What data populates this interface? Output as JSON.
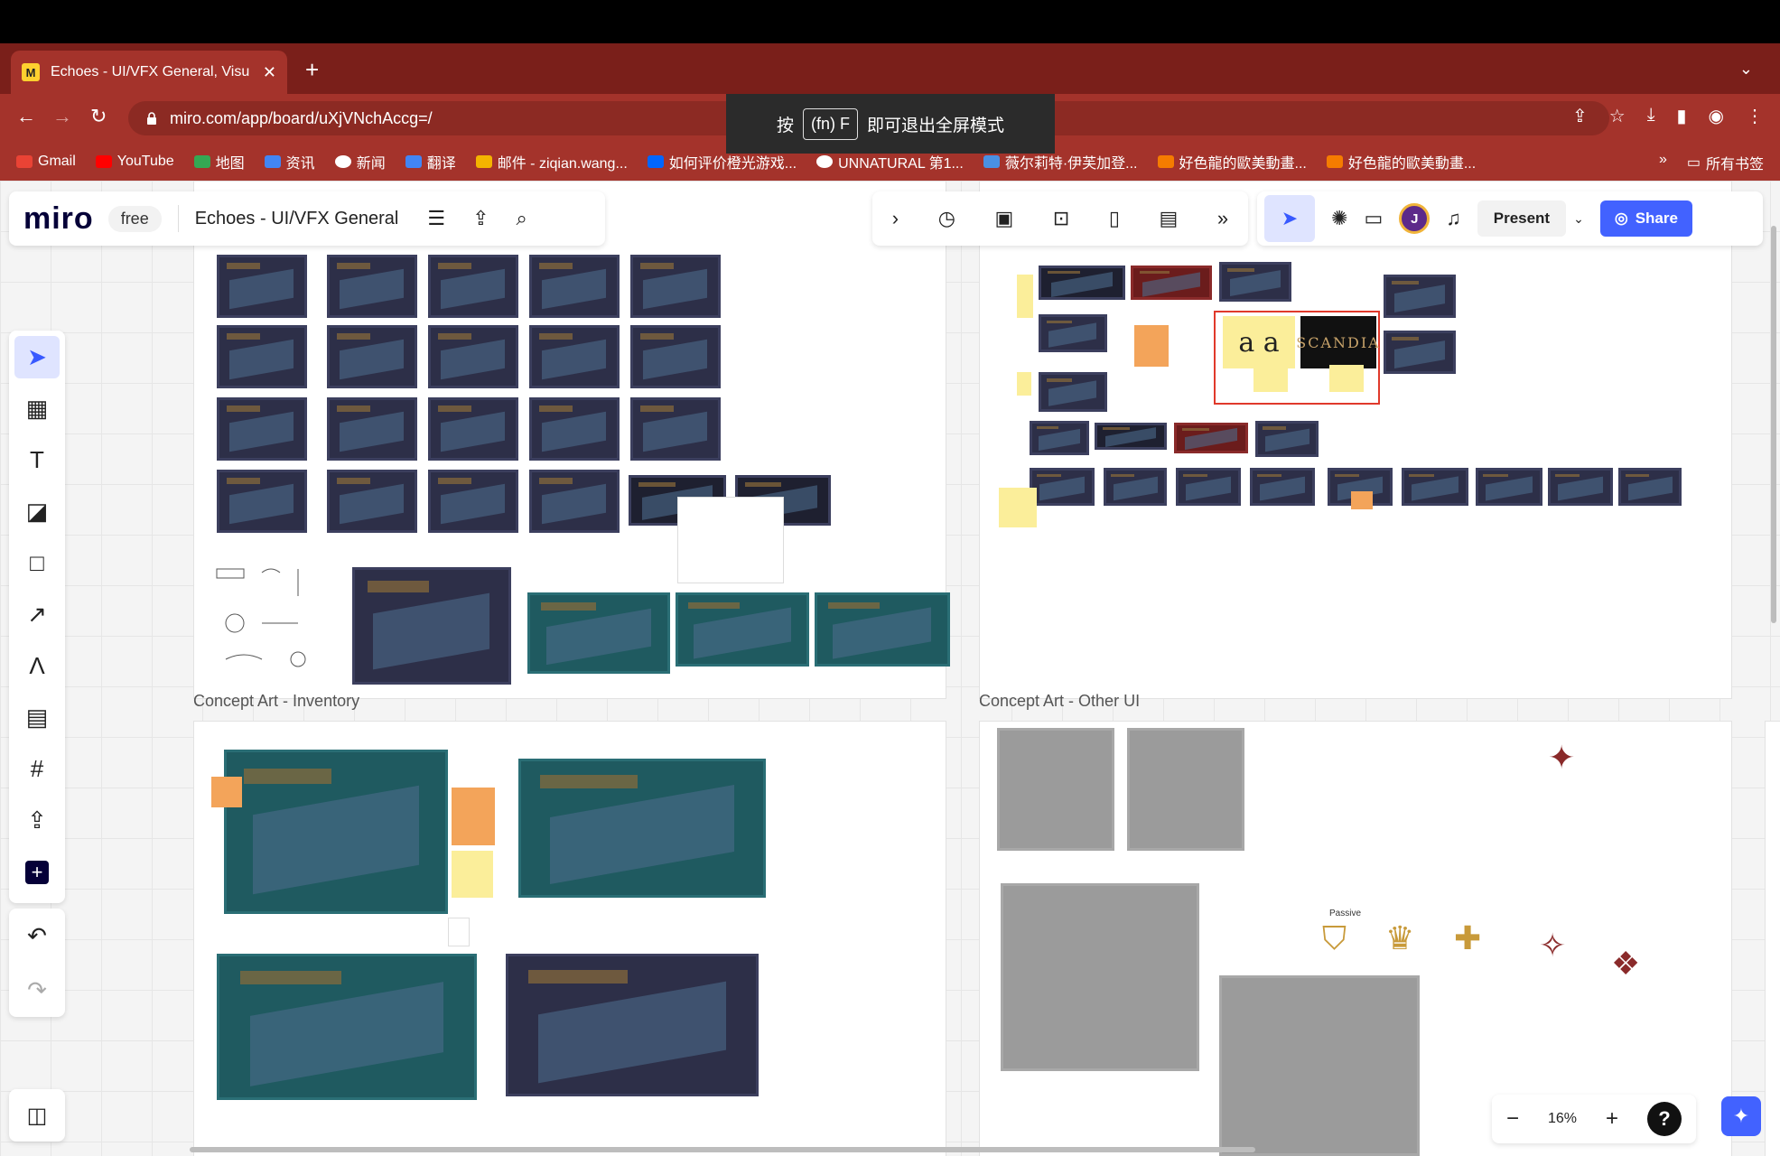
{
  "browser": {
    "tab_title": "Echoes - UI/VFX General, Visu",
    "favicon_letter": "M",
    "url": "miro.com/app/board/uXjVNchAccg=/",
    "fullscreen_toast": {
      "prefix": "按",
      "key": "(fn) F",
      "suffix": "即可退出全屏模式"
    },
    "bookmarks": [
      {
        "label": "Gmail",
        "color": "#ea4335"
      },
      {
        "label": "YouTube",
        "color": "#ff0000"
      },
      {
        "label": "地图",
        "color": "#34a853"
      },
      {
        "label": "资讯",
        "color": "#4285f4"
      },
      {
        "label": "新闻",
        "color": "#ffffff"
      },
      {
        "label": "翻译",
        "color": "#4285f4"
      },
      {
        "label": "邮件 - ziqian.wang...",
        "color": "#f4b400"
      },
      {
        "label": "如何评价橙光游戏...",
        "color": "#0066ff"
      },
      {
        "label": "UNNATURAL 第1...",
        "color": "#ffffff"
      },
      {
        "label": "薇尔莉特·伊芙加登...",
        "color": "#4a90e2"
      },
      {
        "label": "好色龍的歐美動畫...",
        "color": "#f57c00"
      },
      {
        "label": "好色龍的歐美動畫...",
        "color": "#f57c00"
      }
    ],
    "bookmarks_more": "»",
    "all_bookmarks": "所有书签"
  },
  "miro": {
    "logo": "miro",
    "plan": "free",
    "board_name": "Echoes - UI/VFX General",
    "present_label": "Present",
    "share_label": "Share",
    "avatar_initial": "J",
    "zoom": "16%",
    "accent": "#4262ff"
  },
  "board": {
    "frames": [
      {
        "label": "Concept Art - Inventory"
      },
      {
        "label": "Concept Art - Other UI"
      }
    ],
    "passive_label": "Passive",
    "font_samples": [
      "a a",
      "SCANDIA"
    ]
  }
}
